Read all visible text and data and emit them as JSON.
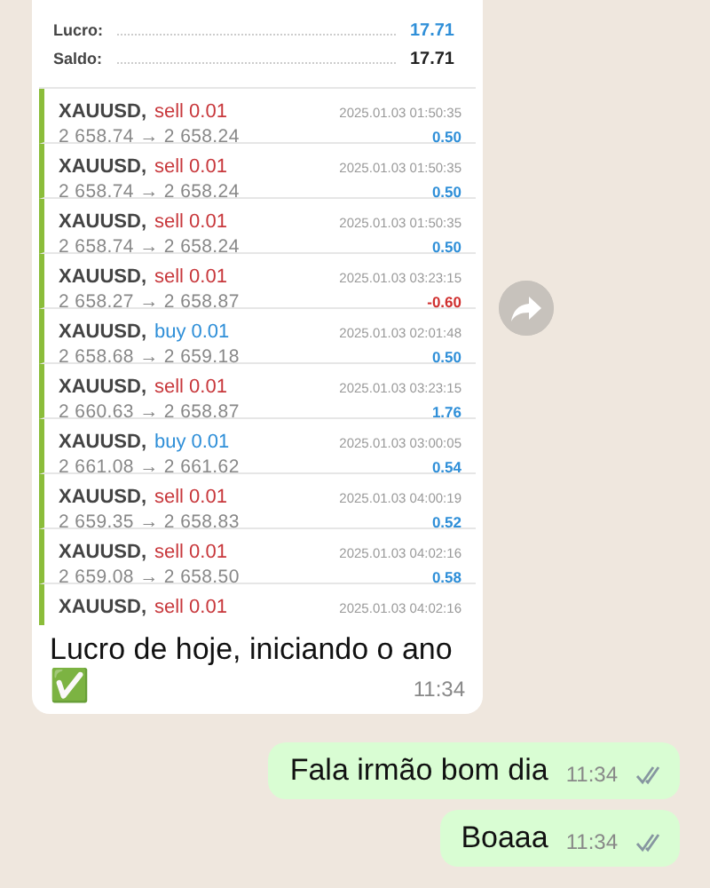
{
  "incoming": {
    "summary": [
      {
        "label": "Lucro:",
        "value": "17.71",
        "highlight": true
      },
      {
        "label": "Saldo:",
        "value": "17.71",
        "highlight": false
      }
    ],
    "trades": [
      {
        "symbol": "XAUUSD,",
        "side": "sell",
        "lot": "0.01",
        "prices": "2 658.74 → 2 658.24",
        "time": "2025.01.03 01:50:35",
        "profit": "0.50",
        "loss": false
      },
      {
        "symbol": "XAUUSD,",
        "side": "sell",
        "lot": "0.01",
        "prices": "2 658.74 → 2 658.24",
        "time": "2025.01.03 01:50:35",
        "profit": "0.50",
        "loss": false
      },
      {
        "symbol": "XAUUSD,",
        "side": "sell",
        "lot": "0.01",
        "prices": "2 658.74 → 2 658.24",
        "time": "2025.01.03 01:50:35",
        "profit": "0.50",
        "loss": false
      },
      {
        "symbol": "XAUUSD,",
        "side": "sell",
        "lot": "0.01",
        "prices": "2 658.27 → 2 658.87",
        "time": "2025.01.03 03:23:15",
        "profit": "-0.60",
        "loss": true
      },
      {
        "symbol": "XAUUSD,",
        "side": "buy",
        "lot": "0.01",
        "prices": "2 658.68 → 2 659.18",
        "time": "2025.01.03 02:01:48",
        "profit": "0.50",
        "loss": false
      },
      {
        "symbol": "XAUUSD,",
        "side": "sell",
        "lot": "0.01",
        "prices": "2 660.63 → 2 658.87",
        "time": "2025.01.03 03:23:15",
        "profit": "1.76",
        "loss": false
      },
      {
        "symbol": "XAUUSD,",
        "side": "buy",
        "lot": "0.01",
        "prices": "2 661.08 → 2 661.62",
        "time": "2025.01.03 03:00:05",
        "profit": "0.54",
        "loss": false
      },
      {
        "symbol": "XAUUSD,",
        "side": "sell",
        "lot": "0.01",
        "prices": "2 659.35 → 2 658.83",
        "time": "2025.01.03 04:00:19",
        "profit": "0.52",
        "loss": false
      },
      {
        "symbol": "XAUUSD,",
        "side": "sell",
        "lot": "0.01",
        "prices": "2 659.08 → 2 658.50",
        "time": "2025.01.03 04:02:16",
        "profit": "0.58",
        "loss": false
      },
      {
        "symbol": "XAUUSD,",
        "side": "sell",
        "lot": "0.01",
        "time": "2025.01.03 04:02:16"
      }
    ],
    "caption": "Lucro de hoje, iniciando o ano",
    "emoji": "✅",
    "time": "11:34"
  },
  "outgoing": [
    {
      "text": "Fala irmão bom dia",
      "time": "11:34",
      "read": false
    },
    {
      "text": "Boaaa",
      "time": "11:34",
      "read": false
    }
  ]
}
